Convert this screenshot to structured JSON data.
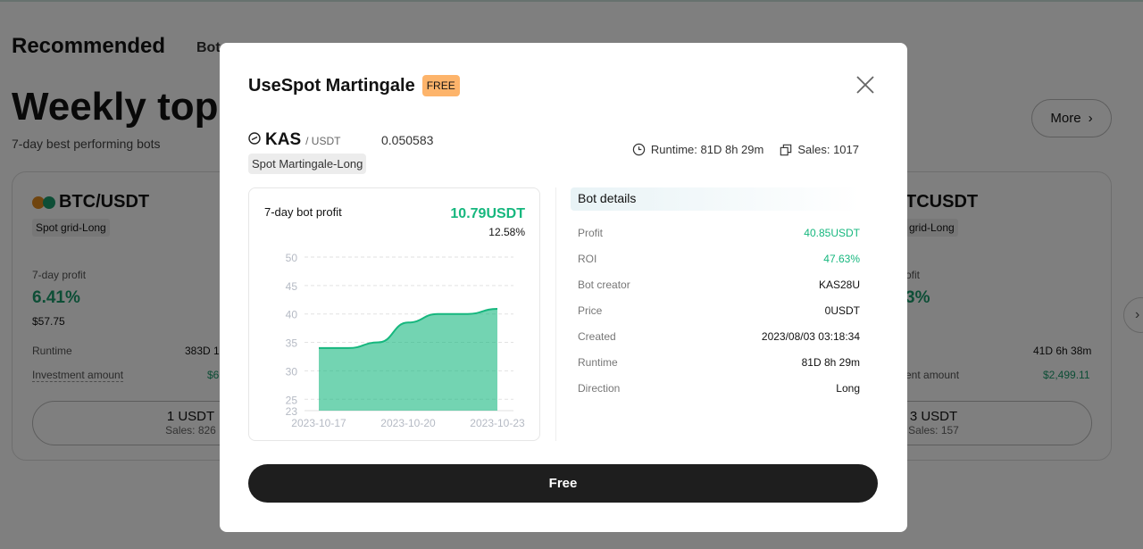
{
  "page": {
    "recommended": "Recommended",
    "bots_tab": "Bot",
    "weekly_title": "Weekly top bots",
    "subtitle": "7-day best performing bots",
    "more": "More"
  },
  "cards": [
    {
      "pair": "BTC/USDT",
      "tag": "Spot grid-Long",
      "profit_label": "7-day profit",
      "profit_pct": "6.41%",
      "profit_usd": "$57.75",
      "runtime_label": "Runtime",
      "runtime": "383D 1",
      "invest_label": "Investment amount",
      "invest": "$6",
      "price": "1 USDT",
      "sales": "Sales: 826"
    },
    {
      "pair": "TCUSDT",
      "tag": "grid-Long",
      "profit_label": "ofit",
      "profit_pct": "3%",
      "runtime": "41D 6h 38m",
      "invest_label": "ent amount",
      "invest": "$2,499.11",
      "price": "3 USDT",
      "sales": "Sales: 157"
    }
  ],
  "modal": {
    "title": "UseSpot Martingale",
    "badge": "FREE",
    "base": "KAS",
    "quote": "/ USDT",
    "price": "0.050583",
    "tag": "Spot Martingale-Long",
    "runtime": "Runtime: 81D 8h 29m",
    "sales": "Sales: 1017",
    "chart_title": "7-day bot profit",
    "chart_value": "10.79USDT",
    "chart_pct": "12.58%",
    "details_title": "Bot details",
    "details": [
      {
        "k": "Profit",
        "v": "40.85USDT",
        "green": true
      },
      {
        "k": "ROI",
        "v": "47.63%",
        "green": true
      },
      {
        "k": "Bot creator",
        "v": "KAS28U"
      },
      {
        "k": "Price",
        "v": "0USDT"
      },
      {
        "k": "Created",
        "v": "2023/08/03 03:18:34"
      },
      {
        "k": "Runtime",
        "v": "81D 8h 29m"
      },
      {
        "k": "Direction",
        "v": "Long"
      }
    ],
    "cta": "Free"
  },
  "colors": {
    "accent": "#16b77e",
    "badge": "#fdb46b",
    "button": "#1e1e1e"
  },
  "chart_data": {
    "type": "area",
    "x": [
      "2023-10-17",
      "2023-10-18",
      "2023-10-19",
      "2023-10-20",
      "2023-10-21",
      "2023-10-22",
      "2023-10-23"
    ],
    "values": [
      34,
      34,
      35,
      38.5,
      40,
      40,
      40.9
    ],
    "x_tick_labels": [
      "2023-10-17",
      "2023-10-20",
      "2023-10-23"
    ],
    "y_ticks": [
      23,
      25,
      30,
      35,
      40,
      45,
      50
    ],
    "ylim": [
      23,
      50
    ],
    "grid": true
  }
}
